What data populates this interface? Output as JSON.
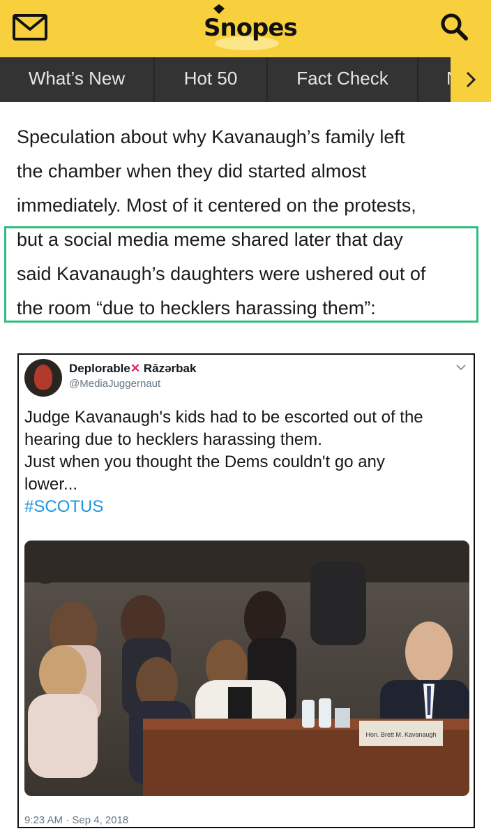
{
  "header": {
    "logo_text": "Snopes",
    "icons": [
      "mail-icon",
      "search-icon"
    ],
    "accent_color": "#f8cf3d"
  },
  "nav": {
    "items": [
      "What’s New",
      "Hot 50",
      "Fact Check",
      "N"
    ],
    "more_icon": "chevron-right-icon"
  },
  "article": {
    "line1": "Speculation about why Kavanaugh’s family left",
    "line2": "the chamber when they did started almost",
    "line3": "immediately. Most of it centered on the protests,",
    "line4": "but a social media meme shared later that day",
    "line5": "said Kavanaugh’s daughters were ushered out of",
    "line6": "the room “due to hecklers harassing them”:",
    "highlight_color": "#2fbf80"
  },
  "tweet": {
    "display_name": "Deplorable",
    "display_name_suffix": "Rāzərbak",
    "handle": "@MediaJuggernaut",
    "text_line1": "Judge Kavanaugh's kids had to be escorted out of the",
    "text_line2": "hearing due to hecklers harassing them.",
    "text_line3": "Just when you thought the Dems couldn't go any",
    "text_line4": "lower...",
    "hashtag": "#SCOTUS",
    "nameplate": "Hon. Brett M. Kavanaugh",
    "timestamp": "9:23 AM · Sep 4, 2018"
  }
}
